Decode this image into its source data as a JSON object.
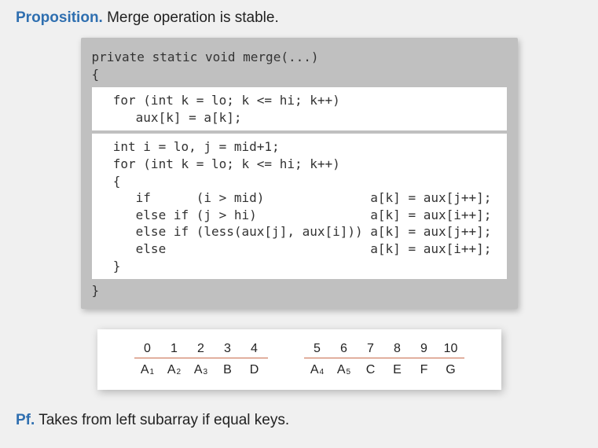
{
  "headline": {
    "label": "Proposition.",
    "text": "Merge operation is stable."
  },
  "code": {
    "signature": "private static void merge(...)\n{",
    "block1": "  for (int k = lo; k <= hi; k++)\n     aux[k] = a[k];",
    "block2": "  int i = lo, j = mid+1;\n  for (int k = lo; k <= hi; k++)\n  {\n     if      (i > mid)              a[k] = aux[j++];\n     else if (j > hi)               a[k] = aux[i++];\n     else if (less(aux[j], aux[i])) a[k] = aux[j++];\n     else                           a[k] = aux[i++];\n  }",
    "close": "}"
  },
  "tables": {
    "left": {
      "indices": [
        "0",
        "1",
        "2",
        "3",
        "4"
      ],
      "values": [
        {
          "base": "A",
          "sub": "1"
        },
        {
          "base": "A",
          "sub": "2"
        },
        {
          "base": "A",
          "sub": "3"
        },
        {
          "base": "B",
          "sub": ""
        },
        {
          "base": "D",
          "sub": ""
        }
      ]
    },
    "right": {
      "indices": [
        "5",
        "6",
        "7",
        "8",
        "9",
        "10"
      ],
      "values": [
        {
          "base": "A",
          "sub": "4"
        },
        {
          "base": "A",
          "sub": "5"
        },
        {
          "base": "C",
          "sub": ""
        },
        {
          "base": "E",
          "sub": ""
        },
        {
          "base": "F",
          "sub": ""
        },
        {
          "base": "G",
          "sub": ""
        }
      ]
    }
  },
  "footline": {
    "label": "Pf.",
    "text": "Takes from left subarray if equal keys."
  },
  "chart_data": {
    "type": "table",
    "title": "Merge subarrays example",
    "left": {
      "indices": [
        0,
        1,
        2,
        3,
        4
      ],
      "values": [
        "A1",
        "A2",
        "A3",
        "B",
        "D"
      ]
    },
    "right": {
      "indices": [
        5,
        6,
        7,
        8,
        9,
        10
      ],
      "values": [
        "A4",
        "A5",
        "C",
        "E",
        "F",
        "G"
      ]
    }
  }
}
